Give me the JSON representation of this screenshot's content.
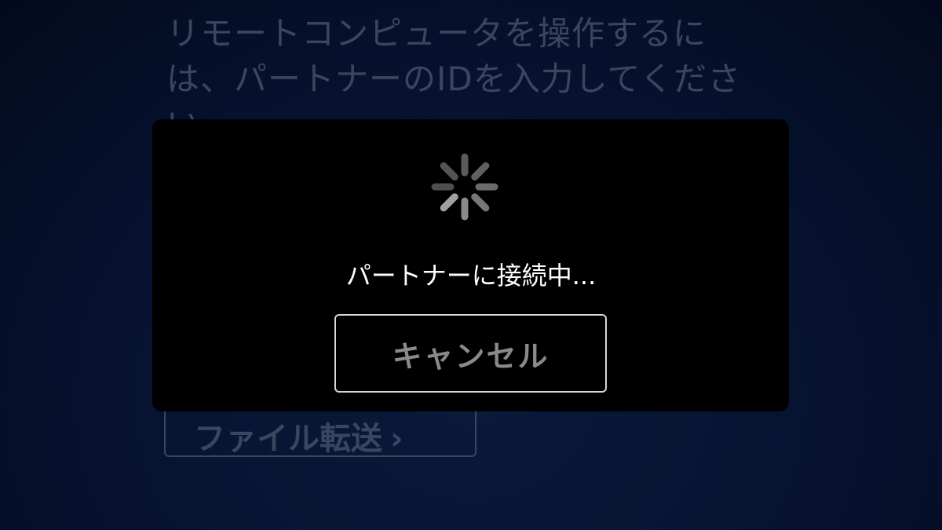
{
  "background": {
    "instruction": "リモートコンピュータを操作するには、パートナーのIDを入力してください。",
    "file_transfer_button": {
      "label": "ファイル転送",
      "chevron": "›",
      "icon": "chevron-right-icon"
    }
  },
  "dialog": {
    "spinner_icon": "loading-spinner-icon",
    "status": "パートナーに接続中...",
    "cancel_label": "キャンセル"
  },
  "colors": {
    "background": "#061230",
    "dimmed_text": "#3a4660",
    "dialog_bg": "#000000",
    "status_text": "#ffffff",
    "cancel_text": "#8a8a8a",
    "cancel_border": "#d8d8d8"
  }
}
